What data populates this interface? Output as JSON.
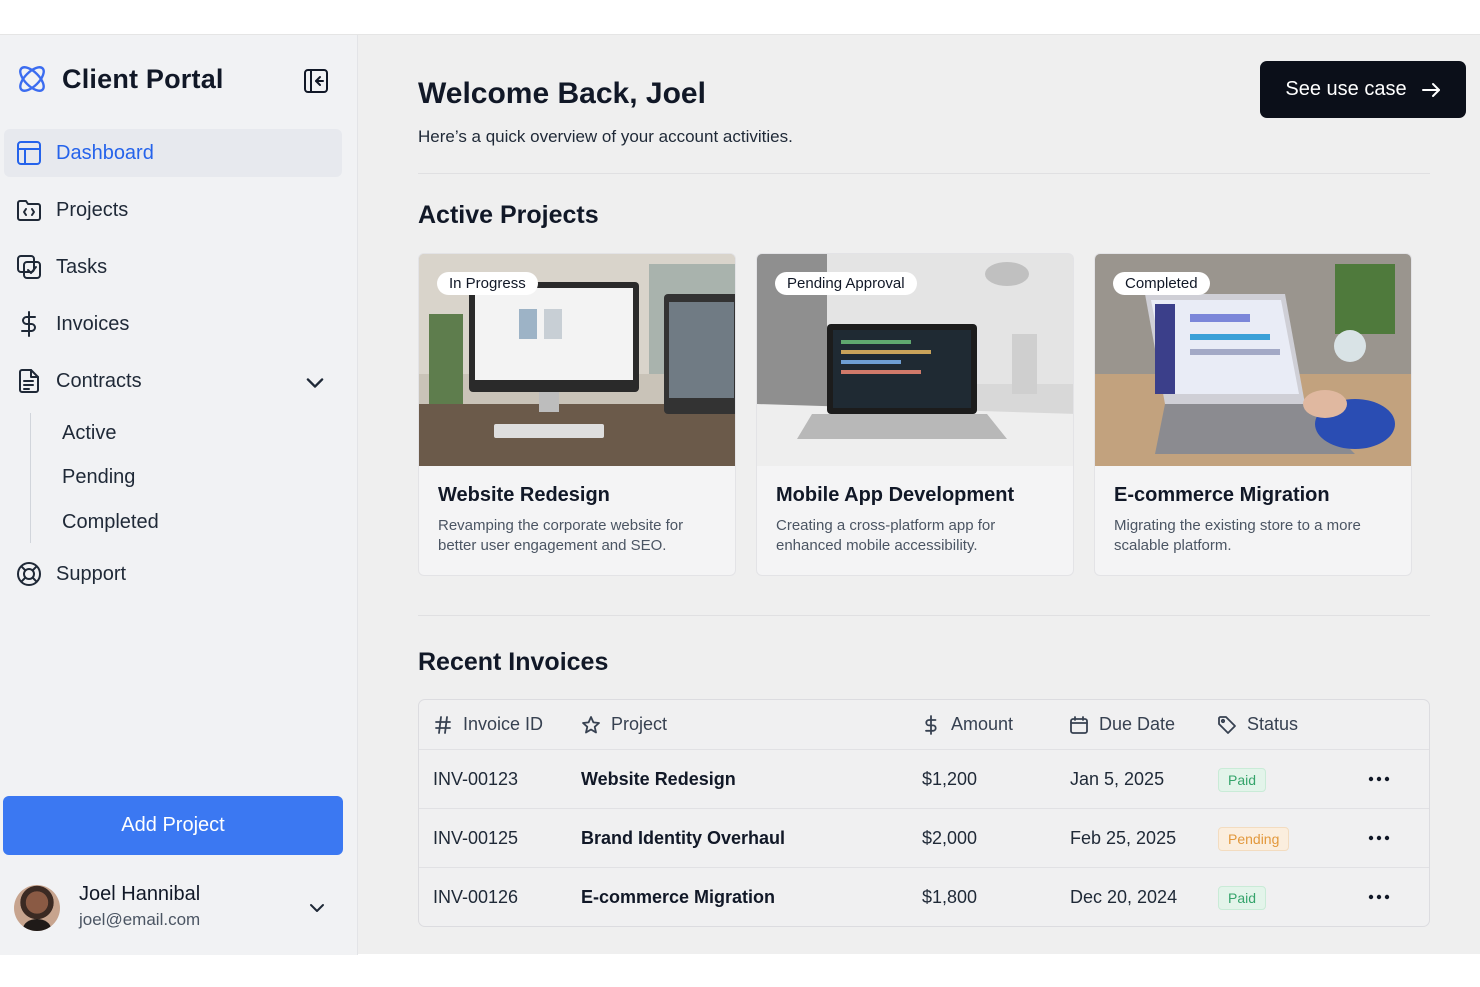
{
  "app": {
    "title": "Client Portal",
    "accent_color": "#2563eb",
    "logo_icon": "atom-logo-icon",
    "collapse_icon": "sidebar-collapse-icon"
  },
  "sidebar": {
    "items": [
      {
        "label": "Dashboard",
        "icon": "dashboard-icon",
        "active": true
      },
      {
        "label": "Projects",
        "icon": "folder-code-icon",
        "active": false
      },
      {
        "label": "Tasks",
        "icon": "tasks-icon",
        "active": false
      },
      {
        "label": "Invoices",
        "icon": "dollar-icon",
        "active": false
      },
      {
        "label": "Contracts",
        "icon": "document-icon",
        "active": false,
        "expanded": true
      },
      {
        "label": "Support",
        "icon": "lifebuoy-icon",
        "active": false
      }
    ],
    "contracts_submenu": [
      "Active",
      "Pending",
      "Completed"
    ],
    "add_button": "Add Project"
  },
  "user": {
    "name": "Joel Hannibal",
    "email": "joel@email.com"
  },
  "header": {
    "welcome": "Welcome Back, Joel",
    "subtitle": "Here’s a quick overview of your account activities.",
    "use_case_button": "See use case"
  },
  "active_projects": {
    "title": "Active Projects",
    "cards": [
      {
        "status": "In Progress",
        "title": "Website Redesign",
        "description": "Revamping the corporate website for better user engagement and SEO."
      },
      {
        "status": "Pending Approval",
        "title": "Mobile App Development",
        "description": "Creating a cross-platform app for enhanced mobile accessibility."
      },
      {
        "status": "Completed",
        "title": "E-commerce Migration",
        "description": "Migrating the existing store to a more scalable platform."
      }
    ]
  },
  "invoices": {
    "title": "Recent Invoices",
    "columns": [
      "Invoice ID",
      "Project",
      "Amount",
      "Due Date",
      "Status"
    ],
    "rows": [
      {
        "id": "INV-00123",
        "project": "Website Redesign",
        "amount": "$1,200",
        "due": "Jan 5, 2025",
        "status": "Paid"
      },
      {
        "id": "INV-00125",
        "project": "Brand Identity Overhaul",
        "amount": "$2,000",
        "due": "Feb 25, 2025",
        "status": "Pending"
      },
      {
        "id": "INV-00126",
        "project": "E-commerce Migration",
        "amount": "$1,800",
        "due": "Dec 20, 2024",
        "status": "Paid"
      }
    ],
    "status_colors": {
      "Paid": "#35a46b",
      "Pending": "#e2983c"
    }
  }
}
